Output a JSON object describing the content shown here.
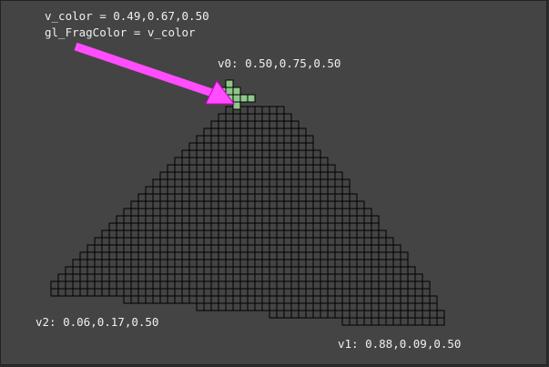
{
  "code": {
    "line1": "v_color = 0.49,0.67,0.50",
    "line2": "gl_FragColor = v_color"
  },
  "vertices": {
    "v0": "v0: 0.50,0.75,0.50",
    "v1": "v1: 0.88,0.09,0.50",
    "v2": "v2: 0.06,0.17,0.50"
  },
  "colors": {
    "background": "#444444",
    "fragment_fill": "#444444",
    "highlight_fill": "#8fc88a",
    "grid_stroke": "#000000",
    "arrow": "#ff4dff",
    "text": "#f0f0f0"
  }
}
